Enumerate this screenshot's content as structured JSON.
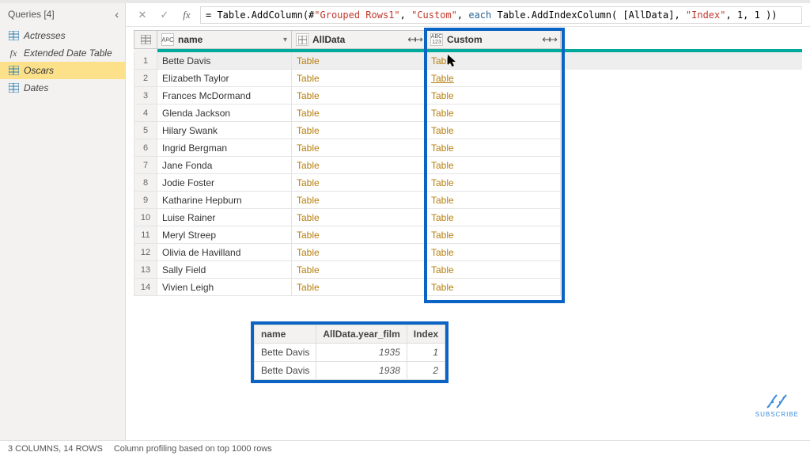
{
  "sidebar": {
    "title": "Queries [4]",
    "items": [
      {
        "icon": "table",
        "label": "Actresses"
      },
      {
        "icon": "fx",
        "label": "Extended Date Table"
      },
      {
        "icon": "table",
        "label": "Oscars"
      },
      {
        "icon": "table",
        "label": "Dates"
      }
    ],
    "selectedIndex": 2
  },
  "formula": {
    "prefix": "= Table.AddColumn(#",
    "str1": "\"Grouped Rows1\"",
    "mid1": ", ",
    "str2": "\"Custom\"",
    "mid2": ", ",
    "kw_each": "each",
    "mid3": " Table.AddIndexColumn( [AllData], ",
    "str3": "\"Index\"",
    "mid4": ", ",
    "n1": "1",
    "mid5": ", ",
    "n2": "1",
    "suffix": " ))"
  },
  "grid": {
    "columns": [
      {
        "typeIcon": "ABC",
        "label": "name"
      },
      {
        "typeIcon": "grid",
        "label": "AllData"
      },
      {
        "typeIcon": "ABC123",
        "label": "Custom"
      }
    ],
    "rows": [
      {
        "idx": "1",
        "name": "Bette Davis",
        "alldata": "Table",
        "custom": "Table"
      },
      {
        "idx": "2",
        "name": "Elizabeth Taylor",
        "alldata": "Table",
        "custom": "Table"
      },
      {
        "idx": "3",
        "name": "Frances McDormand",
        "alldata": "Table",
        "custom": "Table"
      },
      {
        "idx": "4",
        "name": "Glenda Jackson",
        "alldata": "Table",
        "custom": "Table"
      },
      {
        "idx": "5",
        "name": "Hilary Swank",
        "alldata": "Table",
        "custom": "Table"
      },
      {
        "idx": "6",
        "name": "Ingrid Bergman",
        "alldata": "Table",
        "custom": "Table"
      },
      {
        "idx": "7",
        "name": "Jane Fonda",
        "alldata": "Table",
        "custom": "Table"
      },
      {
        "idx": "8",
        "name": "Jodie Foster",
        "alldata": "Table",
        "custom": "Table"
      },
      {
        "idx": "9",
        "name": "Katharine Hepburn",
        "alldata": "Table",
        "custom": "Table"
      },
      {
        "idx": "10",
        "name": "Luise Rainer",
        "alldata": "Table",
        "custom": "Table"
      },
      {
        "idx": "11",
        "name": "Meryl Streep",
        "alldata": "Table",
        "custom": "Table"
      },
      {
        "idx": "12",
        "name": "Olivia de Havilland",
        "alldata": "Table",
        "custom": "Table"
      },
      {
        "idx": "13",
        "name": "Sally Field",
        "alldata": "Table",
        "custom": "Table"
      },
      {
        "idx": "14",
        "name": "Vivien Leigh",
        "alldata": "Table",
        "custom": "Table"
      }
    ]
  },
  "preview": {
    "headers": [
      "name",
      "AllData.year_film",
      "Index"
    ],
    "rows": [
      [
        "Bette Davis",
        "1935",
        "1"
      ],
      [
        "Bette Davis",
        "1938",
        "2"
      ]
    ]
  },
  "statusbar": {
    "left": "3 COLUMNS, 14 ROWS",
    "right": "Column profiling based on top 1000 rows"
  },
  "subscribe": "SUBSCRIBE"
}
